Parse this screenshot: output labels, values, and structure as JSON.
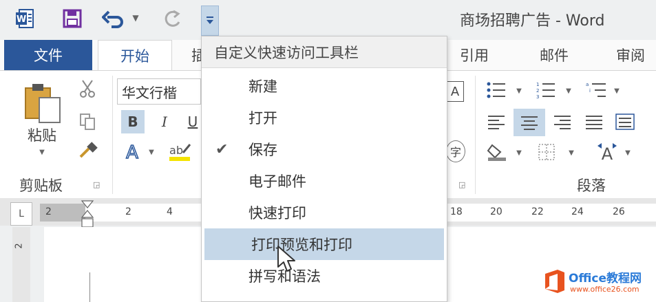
{
  "window": {
    "title": "商场招聘广告 - Word"
  },
  "quick_access": {
    "icons": [
      "word-logo-icon",
      "save-icon",
      "undo-icon",
      "redo-icon",
      "customize-toolbar-icon"
    ]
  },
  "tabs": {
    "file": "文件",
    "home": "开始",
    "insert_partial": "插",
    "references": "引用",
    "mailings": "邮件",
    "review_partial": "审阅"
  },
  "ribbon": {
    "clipboard": {
      "paste_label": "粘贴",
      "group_label": "剪贴板"
    },
    "font": {
      "font_name": "华文行楷",
      "bold": "B",
      "italic": "I",
      "underline": "U"
    },
    "paragraph": {
      "group_label": "段落"
    }
  },
  "ruler": {
    "corner": "L",
    "left_labels": [
      "2",
      "2",
      "4"
    ],
    "right_labels": [
      "18",
      "20",
      "22",
      "24",
      "26"
    ],
    "vertical_label": "2"
  },
  "menu": {
    "header": "自定义快速访问工具栏",
    "items": [
      {
        "label": "新建",
        "checked": false,
        "highlighted": false
      },
      {
        "label": "打开",
        "checked": false,
        "highlighted": false
      },
      {
        "label": "保存",
        "checked": true,
        "highlighted": false
      },
      {
        "label": "电子邮件",
        "checked": false,
        "highlighted": false
      },
      {
        "label": "快速打印",
        "checked": false,
        "highlighted": false
      },
      {
        "label": "打印预览和打印",
        "checked": false,
        "highlighted": true
      },
      {
        "label": "拼写和语法",
        "checked": false,
        "highlighted": false
      }
    ]
  },
  "watermark": {
    "brand": "Office教程网",
    "url": "www.office26.com"
  },
  "colors": {
    "accent": "#2b579a",
    "highlight": "#c5d7e8",
    "watermark_orange": "#e8531f"
  }
}
